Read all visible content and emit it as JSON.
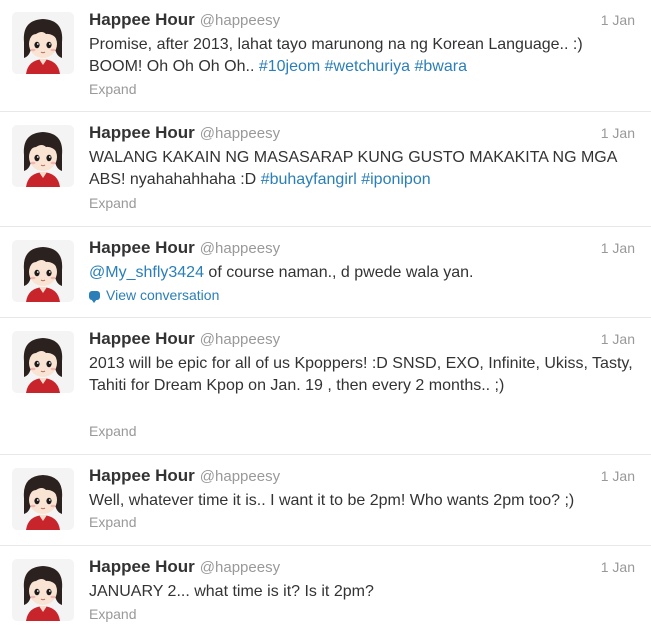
{
  "tweets": [
    {
      "name": "Happee Hour",
      "handle": "@happeesy",
      "time": "1 Jan",
      "text_parts": [
        {
          "t": "Promise, after 2013, lahat tayo marunong na ng Korean Language.. :) BOOM! Oh Oh Oh Oh.. ",
          "kind": "text"
        },
        {
          "t": "#10jeom",
          "kind": "hashtag"
        },
        {
          "t": " ",
          "kind": "text"
        },
        {
          "t": "#wetchuriya",
          "kind": "hashtag"
        },
        {
          "t": " ",
          "kind": "text"
        },
        {
          "t": "#bwara",
          "kind": "hashtag"
        }
      ],
      "action": "Expand"
    },
    {
      "name": "Happee Hour",
      "handle": "@happeesy",
      "time": "1 Jan",
      "text_parts": [
        {
          "t": "WALANG KAKAIN NG MASASARAP KUNG GUSTO MAKAKITA NG MGA ABS! nyahahahhaha :D ",
          "kind": "text"
        },
        {
          "t": "#buhayfangirl",
          "kind": "hashtag"
        },
        {
          "t": " ",
          "kind": "text"
        },
        {
          "t": "#iponipon",
          "kind": "hashtag"
        }
      ],
      "action": "Expand"
    },
    {
      "name": "Happee Hour",
      "handle": "@happeesy",
      "time": "1 Jan",
      "text_parts": [
        {
          "t": "@My_shfly3424",
          "kind": "mention"
        },
        {
          "t": " of course naman., d pwede wala yan.",
          "kind": "text"
        }
      ],
      "action": "View conversation"
    },
    {
      "name": "Happee Hour",
      "handle": "@happeesy",
      "time": "1 Jan",
      "text_parts": [
        {
          "t": "2013 will be epic for all of us Kpoppers! :D SNSD, EXO, Infinite, Ukiss, Tasty, Tahiti for Dream Kpop on Jan. 19 , then every 2 months.. ;)",
          "kind": "text"
        }
      ],
      "action": "Expand"
    },
    {
      "name": "Happee Hour",
      "handle": "@happeesy",
      "time": "1 Jan",
      "text_parts": [
        {
          "t": "Well, whatever time it is.. I want it to be 2pm! Who wants 2pm too? ;)",
          "kind": "text"
        }
      ],
      "action": "Expand"
    },
    {
      "name": "Happee Hour",
      "handle": "@happeesy",
      "time": "1 Jan",
      "text_parts": [
        {
          "t": "JANUARY 2... what time is it? Is it 2pm?",
          "kind": "text"
        }
      ],
      "action": "Expand"
    }
  ],
  "icons": {
    "avatar": "avatar-girl-icon",
    "conversation": "speech-bubble-icon"
  }
}
